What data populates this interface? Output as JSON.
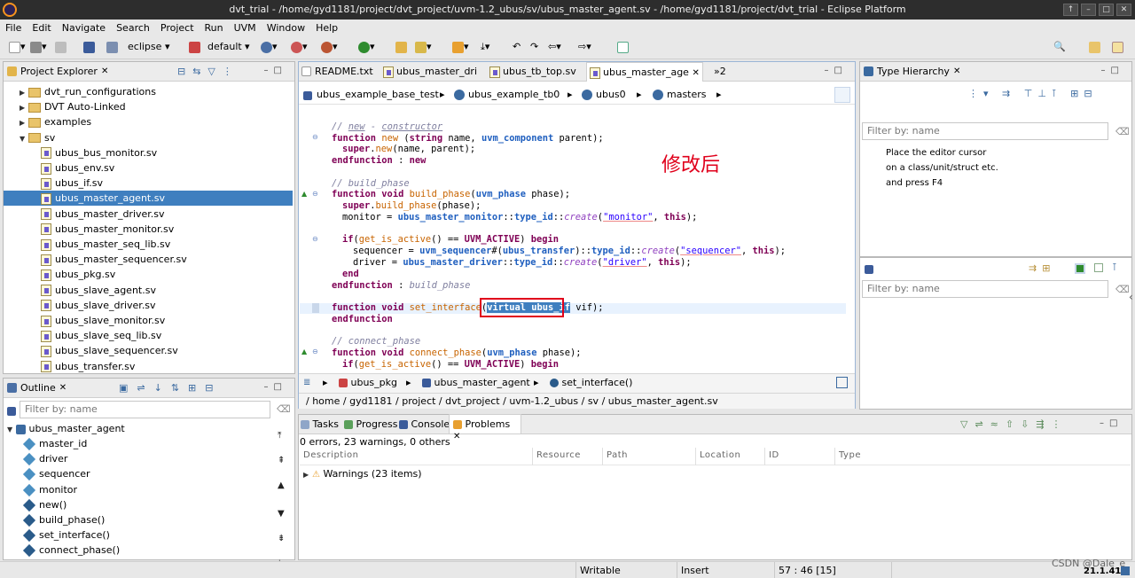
{
  "window": {
    "title": "dvt_trial - /home/gyd1181/project/dvt_project/uvm-1.2_ubus/sv/ubus_master_agent.sv - /home/gyd1181/project/dvt_trial - Eclipse Platform"
  },
  "menu": [
    "File",
    "Edit",
    "Navigate",
    "Search",
    "Project",
    "Run",
    "UVM",
    "Window",
    "Help"
  ],
  "toolbar": {
    "perspective_label": "eclipse",
    "config_label": "default"
  },
  "project_explorer": {
    "title": "Project Explorer",
    "items": [
      {
        "label": "dvt_run_configurations",
        "kind": "folder",
        "expanded": false
      },
      {
        "label": "DVT Auto-Linked",
        "kind": "folder",
        "expanded": false
      },
      {
        "label": "examples",
        "kind": "folder",
        "expanded": false
      },
      {
        "label": "sv",
        "kind": "folder",
        "expanded": true
      },
      {
        "label": "ubus_bus_monitor.sv",
        "kind": "file"
      },
      {
        "label": "ubus_env.sv",
        "kind": "file"
      },
      {
        "label": "ubus_if.sv",
        "kind": "file"
      },
      {
        "label": "ubus_master_agent.sv",
        "kind": "file",
        "selected": true
      },
      {
        "label": "ubus_master_driver.sv",
        "kind": "file"
      },
      {
        "label": "ubus_master_monitor.sv",
        "kind": "file"
      },
      {
        "label": "ubus_master_seq_lib.sv",
        "kind": "file"
      },
      {
        "label": "ubus_master_sequencer.sv",
        "kind": "file"
      },
      {
        "label": "ubus_pkg.sv",
        "kind": "file"
      },
      {
        "label": "ubus_slave_agent.sv",
        "kind": "file"
      },
      {
        "label": "ubus_slave_driver.sv",
        "kind": "file"
      },
      {
        "label": "ubus_slave_monitor.sv",
        "kind": "file"
      },
      {
        "label": "ubus_slave_seq_lib.sv",
        "kind": "file"
      },
      {
        "label": "ubus_slave_sequencer.sv",
        "kind": "file"
      },
      {
        "label": "ubus_transfer.sv",
        "kind": "file"
      }
    ]
  },
  "outline": {
    "title": "Outline",
    "filter_placeholder": "Filter by: name",
    "root": "ubus_master_agent",
    "items": [
      "master_id",
      "driver",
      "sequencer",
      "monitor",
      "new()",
      "build_phase()",
      "set_interface()",
      "connect_phase()"
    ]
  },
  "editor": {
    "tabs": [
      {
        "label": "README.txt",
        "active": false
      },
      {
        "label": "ubus_master_dri",
        "active": false
      },
      {
        "label": "ubus_tb_top.sv",
        "active": false
      },
      {
        "label": "ubus_master_age",
        "active": true,
        "closable": true
      }
    ],
    "overflow_label": "»2",
    "breadcrumb_top": [
      "ubus_example_base_test",
      "ubus_example_tb0",
      "ubus0",
      "masters"
    ],
    "annotation": "修改后",
    "breadcrumb_bottom": [
      "ubus_pkg",
      "ubus_master_agent",
      "set_interface()"
    ],
    "path": "/ home / gyd1181 / project / dvt_project / uvm-1.2_ubus / sv / ubus_master_agent.sv"
  },
  "code": {
    "l1_c": "// ",
    "l1_new": "new",
    "l1_dash": " - ",
    "l1_ctor": "constructor",
    "l2_kw": "function",
    "l2_fn": "new",
    "l2_a": " (",
    "l2_t": "string",
    "l2_b": " name, ",
    "l2_t2": "uvm_component",
    "l2_c": " parent);",
    "l3_kw": "super",
    "l3_a": ".",
    "l3_fn": "new",
    "l3_b": "(name, parent);",
    "l4_kw": "endfunction",
    "l4_a": " : ",
    "l4_kw2": "new",
    "l5_c": "// build_phase",
    "l6_kw": "function void",
    "l6_fn": "build_phase",
    "l6_a": "(",
    "l6_t": "uvm_phase",
    "l6_b": " phase);",
    "l7_kw": "super",
    "l7_a": ".",
    "l7_fn": "build_phase",
    "l7_b": "(phase);",
    "l8_a": "monitor = ",
    "l8_t": "ubus_master_monitor",
    "l8_b": "::",
    "l8_t2": "type_id",
    "l8_c": "::",
    "l8_ct": "create",
    "l8_d": "(",
    "l8_s": "\"monitor\"",
    "l8_e": ", ",
    "l8_kw": "this",
    "l8_f": ");",
    "l9_kw": "if",
    "l9_a": "(",
    "l9_fn": "get_is_active",
    "l9_b": "() == ",
    "l9_kw2": "UVM_ACTIVE",
    "l9_c": ") ",
    "l9_kw3": "begin",
    "l10_a": "sequencer = ",
    "l10_t": "uvm_sequencer",
    "l10_b": "#(",
    "l10_t2": "ubus_transfer",
    "l10_c": ")::",
    "l10_t3": "type_id",
    "l10_d": "::",
    "l10_ct": "create",
    "l10_e": "(",
    "l10_s": "\"sequencer\"",
    "l10_f": ", ",
    "l10_kw": "this",
    "l10_g": ");",
    "l11_a": "driver = ",
    "l11_t": "ubus_master_driver",
    "l11_b": "::",
    "l11_t2": "type_id",
    "l11_c": "::",
    "l11_ct": "create",
    "l11_d": "(",
    "l11_s": "\"driver\"",
    "l11_e": ", ",
    "l11_kw": "this",
    "l11_f": ");",
    "l12_kw": "end",
    "l13_kw": "endfunction",
    "l13_a": " : ",
    "l13_c": "build_phase",
    "l14_kw": "function void",
    "l14_fn": "set_interface",
    "l14_a": "(",
    "l14_hl": "virtual ubus_if",
    "l14_b": " vif);",
    "l15_kw": "endfunction",
    "l16_c": "// connect_phase",
    "l17_kw": "function void",
    "l17_fn": "connect_phase",
    "l17_a": "(",
    "l17_t": "uvm_phase",
    "l17_b": " phase);",
    "l18_kw": "if",
    "l18_a": "(",
    "l18_fn": "get_is_active",
    "l18_b": "() == ",
    "l18_kw2": "UVM_ACTIVE",
    "l18_c": ") ",
    "l18_kw3": "begin"
  },
  "type_hierarchy": {
    "title": "Type Hierarchy",
    "filter_placeholder": "Filter by: name",
    "hint": [
      "Place the editor cursor",
      "on a class/unit/struct etc.",
      "and press F4"
    ],
    "filter2_placeholder": "Filter by: name"
  },
  "bottom_panel": {
    "tabs": [
      {
        "label": "Tasks",
        "active": false
      },
      {
        "label": "Progress",
        "active": false
      },
      {
        "label": "Console",
        "active": false
      },
      {
        "label": "Problems",
        "active": true
      }
    ],
    "summary": "0 errors, 23 warnings, 0 others",
    "columns": [
      "Description",
      "Resource",
      "Path",
      "Location",
      "ID",
      "Type"
    ],
    "rows": [
      {
        "label": "Warnings (23 items)"
      }
    ]
  },
  "statusbar": {
    "writable": "Writable",
    "insert": "Insert",
    "position": "57 : 46 [15]",
    "version": "21.1.41",
    "watermark": "CSDN @Dale_e"
  },
  "colors": {
    "selection": "#3f7fbf",
    "highlight_box": "#e0001b",
    "annotation": "#e0001b"
  }
}
